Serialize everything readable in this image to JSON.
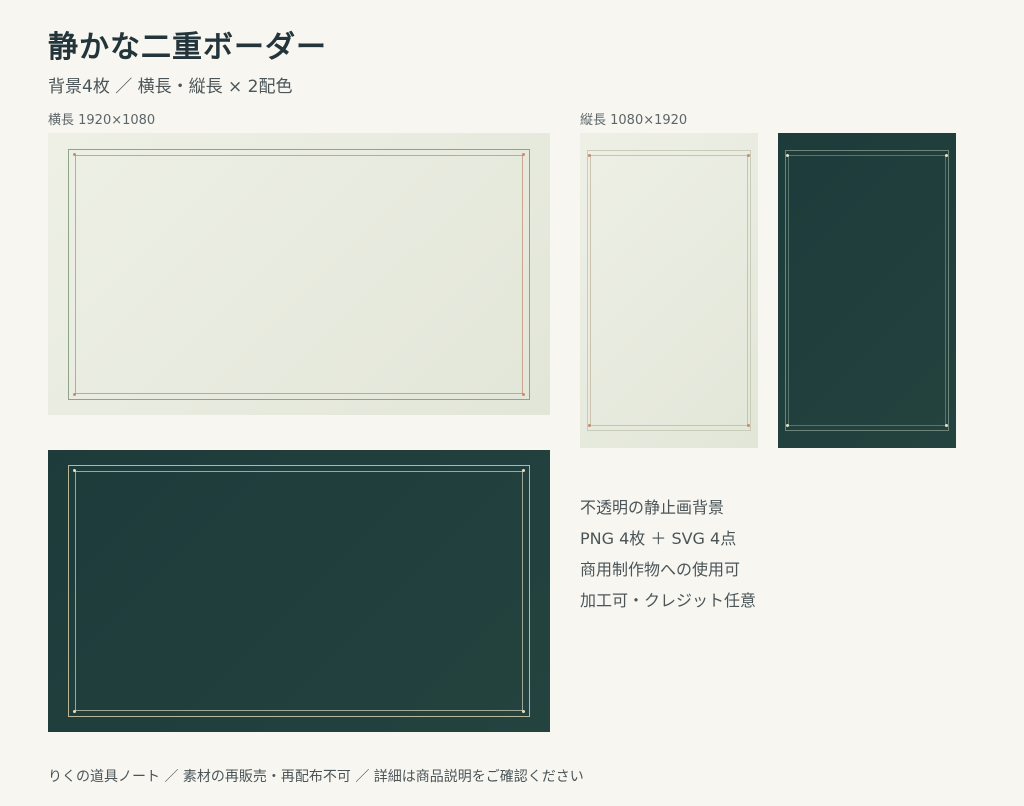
{
  "title": "静かな二重ボーダー",
  "subtitle": "背景4枚 ／ 横長・縦長 × 2配色",
  "labels": {
    "horizontal": "横長 1920×1080",
    "vertical": "縦長 1080×1920"
  },
  "previews": [
    {
      "orientation": "horizontal",
      "scheme": "light"
    },
    {
      "orientation": "horizontal",
      "scheme": "dark"
    },
    {
      "orientation": "vertical",
      "scheme": "light"
    },
    {
      "orientation": "vertical",
      "scheme": "dark"
    }
  ],
  "colors": {
    "background": "#f7f6f1",
    "light_panel": "#e6e9dc",
    "dark_panel": "#1f3e3c",
    "accent_copper": "#c48d70",
    "accent_sage": "#8fa486"
  },
  "features": [
    "不透明の静止画背景",
    "PNG 4枚 ＋ SVG 4点",
    "商用制作物への使用可",
    "加工可・クレジット任意"
  ],
  "footer": "りくの道具ノート ／ 素材の再販売・再配布不可 ／ 詳細は商品説明をご確認ください"
}
